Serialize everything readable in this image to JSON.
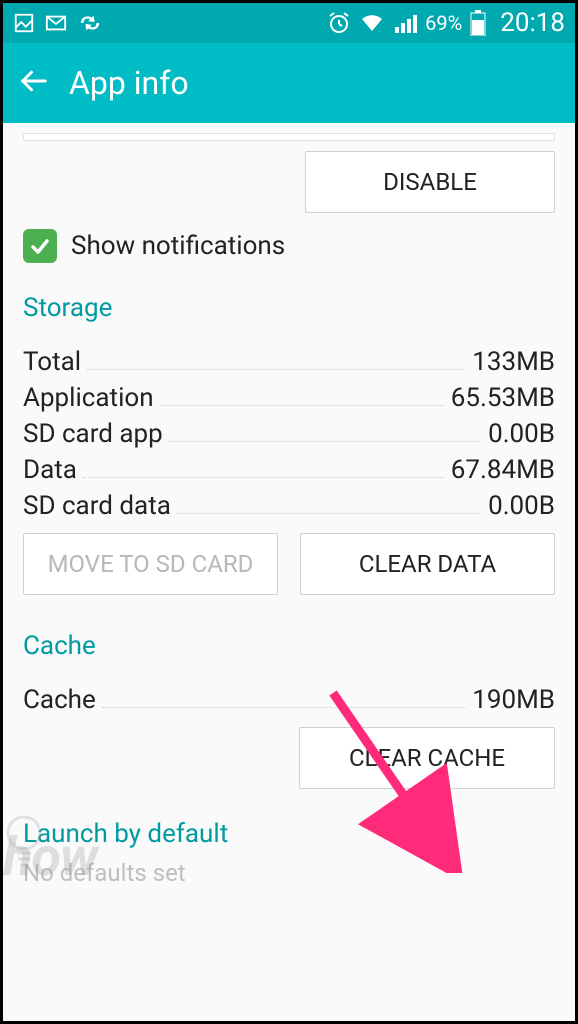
{
  "status": {
    "battery_pct": "69%",
    "clock": "20:18"
  },
  "appbar": {
    "title": "App info"
  },
  "partial_button_top": "",
  "disable_label": "DISABLE",
  "notifications": {
    "checked": true,
    "label": "Show notifications"
  },
  "storage": {
    "title": "Storage",
    "rows": [
      {
        "k": "Total",
        "v": "133MB"
      },
      {
        "k": "Application",
        "v": "65.53MB"
      },
      {
        "k": "SD card app",
        "v": "0.00B"
      },
      {
        "k": "Data",
        "v": "67.84MB"
      },
      {
        "k": "SD card data",
        "v": "0.00B"
      }
    ],
    "move_label": "MOVE TO SD CARD",
    "clear_data_label": "CLEAR DATA"
  },
  "cache": {
    "title": "Cache",
    "row": {
      "k": "Cache",
      "v": "190MB"
    },
    "clear_cache_label": "CLEAR CACHE"
  },
  "launch": {
    "title": "Launch by default",
    "sub": "No defaults set"
  },
  "watermark": "how"
}
